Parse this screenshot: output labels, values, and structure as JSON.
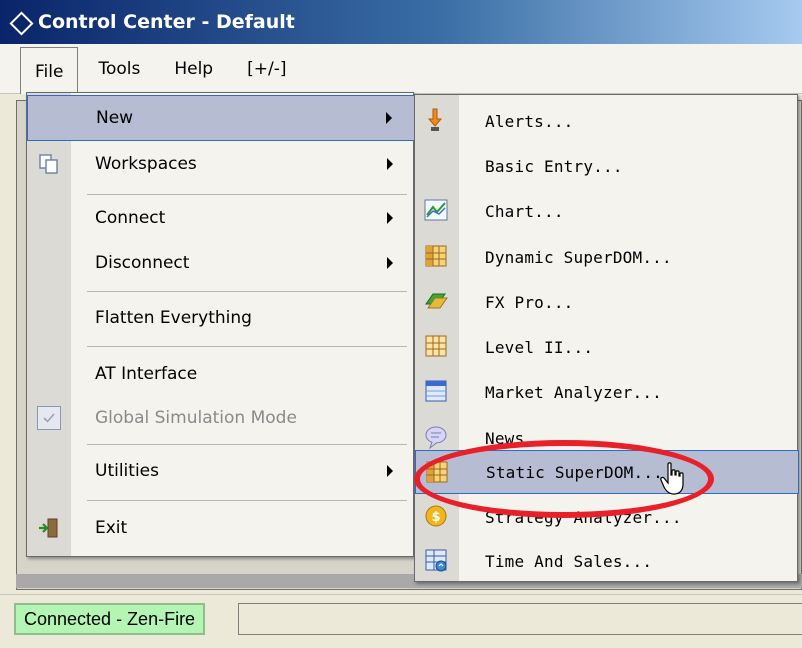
{
  "window": {
    "title": "Control Center - Default"
  },
  "menubar": {
    "items": [
      {
        "label": "File",
        "active": true
      },
      {
        "label": "Tools",
        "active": false
      },
      {
        "label": "Help",
        "active": false
      },
      {
        "label": "[+/-]",
        "active": false
      }
    ]
  },
  "file_menu": {
    "items": [
      {
        "label": "New",
        "has_submenu": true,
        "highlighted": true,
        "icon": ""
      },
      {
        "label": "Workspaces",
        "has_submenu": true,
        "icon": "copy-pages-icon"
      },
      {
        "label": "Connect",
        "has_submenu": true,
        "icon": ""
      },
      {
        "label": "Disconnect",
        "has_submenu": true,
        "icon": ""
      },
      {
        "label": "Flatten Everything",
        "has_submenu": false,
        "icon": ""
      },
      {
        "label": "AT Interface",
        "has_submenu": false,
        "icon": ""
      },
      {
        "label": "Global Simulation Mode",
        "has_submenu": false,
        "disabled": true,
        "icon": "checkmark-icon"
      },
      {
        "label": "Utilities",
        "has_submenu": true,
        "icon": ""
      },
      {
        "label": "Exit",
        "has_submenu": false,
        "icon": "exit-door-icon"
      }
    ]
  },
  "new_submenu": {
    "items": [
      {
        "label": "Alerts...",
        "icon": "alert-hand-icon"
      },
      {
        "label": "Basic Entry...",
        "icon": ""
      },
      {
        "label": "Chart...",
        "icon": "chart-icon"
      },
      {
        "label": "Dynamic SuperDOM...",
        "icon": "superdom-grid-icon"
      },
      {
        "label": "FX Pro...",
        "icon": "fx-pro-icon"
      },
      {
        "label": "Level II...",
        "icon": "level-ii-grid-icon"
      },
      {
        "label": "Market Analyzer...",
        "icon": "market-analyzer-icon"
      },
      {
        "label": "News...",
        "icon": "news-bubble-icon"
      },
      {
        "label": "Static SuperDOM...",
        "icon": "static-superdom-icon",
        "highlighted": true
      },
      {
        "label": "Strategy Analyzer...",
        "icon": "strategy-analyzer-coin-icon"
      },
      {
        "label": "Time And Sales...",
        "icon": "time-and-sales-icon"
      }
    ]
  },
  "statusbar": {
    "connection": "Connected - Zen-Fire"
  },
  "colors": {
    "highlight": "#b6bdd2",
    "annotation": "#e8202a",
    "connected_bg": "#b4f5b4"
  }
}
